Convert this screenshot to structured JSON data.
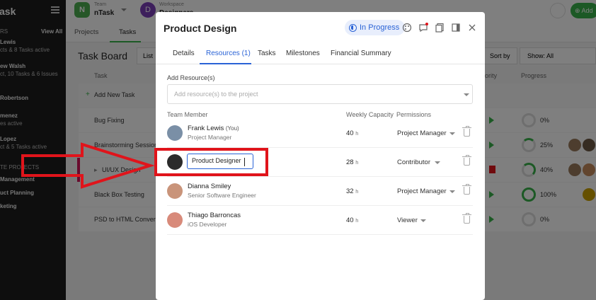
{
  "sidebar": {
    "logo": "ask",
    "section_label": "RS",
    "view_all": "View All",
    "people": [
      {
        "name": "Lewis",
        "meta": "cts & 8 Tasks active"
      },
      {
        "name": "ew Walsh",
        "meta": "ct, 10 Tasks & 6 Issues"
      },
      {
        "name": "Robertson",
        "meta": ""
      },
      {
        "name": "menez",
        "meta": "es active"
      },
      {
        "name": "Lopez",
        "meta": "ct & 5 Tasks active"
      }
    ],
    "projects_label": "TE PROJECTS",
    "projects": [
      "Management",
      "uct Planning",
      "keting"
    ]
  },
  "topbar": {
    "team_label": "Team",
    "team_name": "nTask",
    "team_initial": "N",
    "workspace_label": "Workspace",
    "workspace_initial": "D",
    "workspace_name": "Designers",
    "add_label": "Add"
  },
  "subbar": {
    "tabs": [
      "Projects",
      "Tasks"
    ],
    "active": "Tasks"
  },
  "board": {
    "title": "Task Board",
    "list_label": "List",
    "sort_label": "Sort by",
    "show_label": "Show: All",
    "col_task": "Task",
    "col_priority": "riority",
    "col_progress": "Progress",
    "add_task": "Add New Task",
    "rows": [
      {
        "name": "Bug Fixing",
        "progress": "0%"
      },
      {
        "name": "Brainstorming Session",
        "progress": "25%"
      },
      {
        "name": "UI/UX Design",
        "progress": "40%"
      },
      {
        "name": "Black Box Testing",
        "progress": "100%"
      },
      {
        "name": "PSD to HTML Convers",
        "progress": "0%"
      }
    ]
  },
  "modal": {
    "title": "Product Design",
    "status": "In Progress",
    "tabs": [
      "Details",
      "Resources (1)",
      "Tasks",
      "Milestones",
      "Financial Summary"
    ],
    "active_tab": "Resources (1)",
    "add_resources_label": "Add Resource(s)",
    "add_resources_placeholder": "Add resource(s) to the project",
    "col_member": "Team Member",
    "col_capacity": "Weekly Capacity",
    "col_permissions": "Permissions",
    "capacity_unit": "h",
    "members": [
      {
        "name": "Frank Lewis",
        "you": "(You)",
        "role": "Project Manager",
        "capacity": "40",
        "permission": "Project Manager"
      },
      {
        "name": "",
        "role": "",
        "role_edit_value": "Product Designer",
        "capacity": "28",
        "permission": "Contributor"
      },
      {
        "name": "Dianna Smiley",
        "role": "Senior Software Engineer",
        "capacity": "32",
        "permission": "Project Manager"
      },
      {
        "name": "Thiago Barroncas",
        "role": "iOS Developer",
        "capacity": "40",
        "permission": "Viewer"
      }
    ]
  },
  "colors": {
    "accent": "#2a63d6",
    "annotation_red": "#e0141b",
    "green": "#38b24a"
  }
}
